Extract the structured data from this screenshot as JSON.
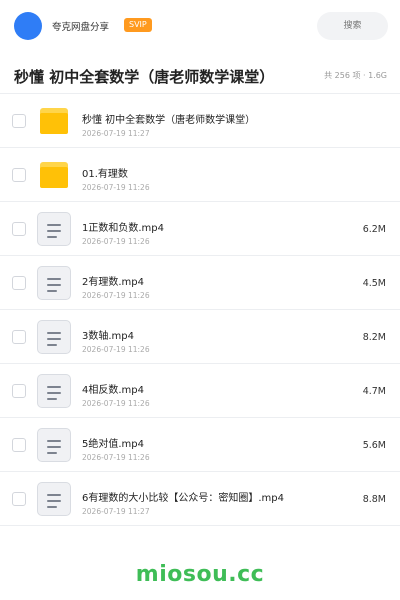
{
  "header": {
    "username": "夸克网盘分享",
    "badge": "SVIP",
    "search_placeholder": "搜索",
    "avatar_color": "#2f7df6"
  },
  "folder": {
    "title": "秒懂 初中全套数学（唐老师数学课堂）",
    "summary": "共 256 项 · 1.6G"
  },
  "files": [
    {
      "type": "folder",
      "name": "秒懂 初中全套数学（唐老师数学课堂）",
      "date": "2026-07-19 11:27",
      "size": ""
    },
    {
      "type": "folder",
      "name": "01.有理数",
      "date": "2026-07-19 11:26",
      "size": ""
    },
    {
      "type": "file",
      "name": "1正数和负数.mp4",
      "date": "2026-07-19 11:26",
      "size": "6.2M"
    },
    {
      "type": "file",
      "name": "2有理数.mp4",
      "date": "2026-07-19 11:26",
      "size": "4.5M"
    },
    {
      "type": "file",
      "name": "3数轴.mp4",
      "date": "2026-07-19 11:26",
      "size": "8.2M"
    },
    {
      "type": "file",
      "name": "4相反数.mp4",
      "date": "2026-07-19 11:26",
      "size": "4.7M"
    },
    {
      "type": "file",
      "name": "5绝对值.mp4",
      "date": "2026-07-19 11:26",
      "size": "5.6M"
    },
    {
      "type": "file",
      "name": "6有理数的大小比较【公众号：密知圈】.mp4",
      "date": "2026-07-19 11:27",
      "size": "8.8M"
    }
  ],
  "watermark": "miosou.cc",
  "colors": {
    "folder": "#ffc107",
    "svip": "#ff9a1f",
    "watermark": "#3fbd57"
  }
}
